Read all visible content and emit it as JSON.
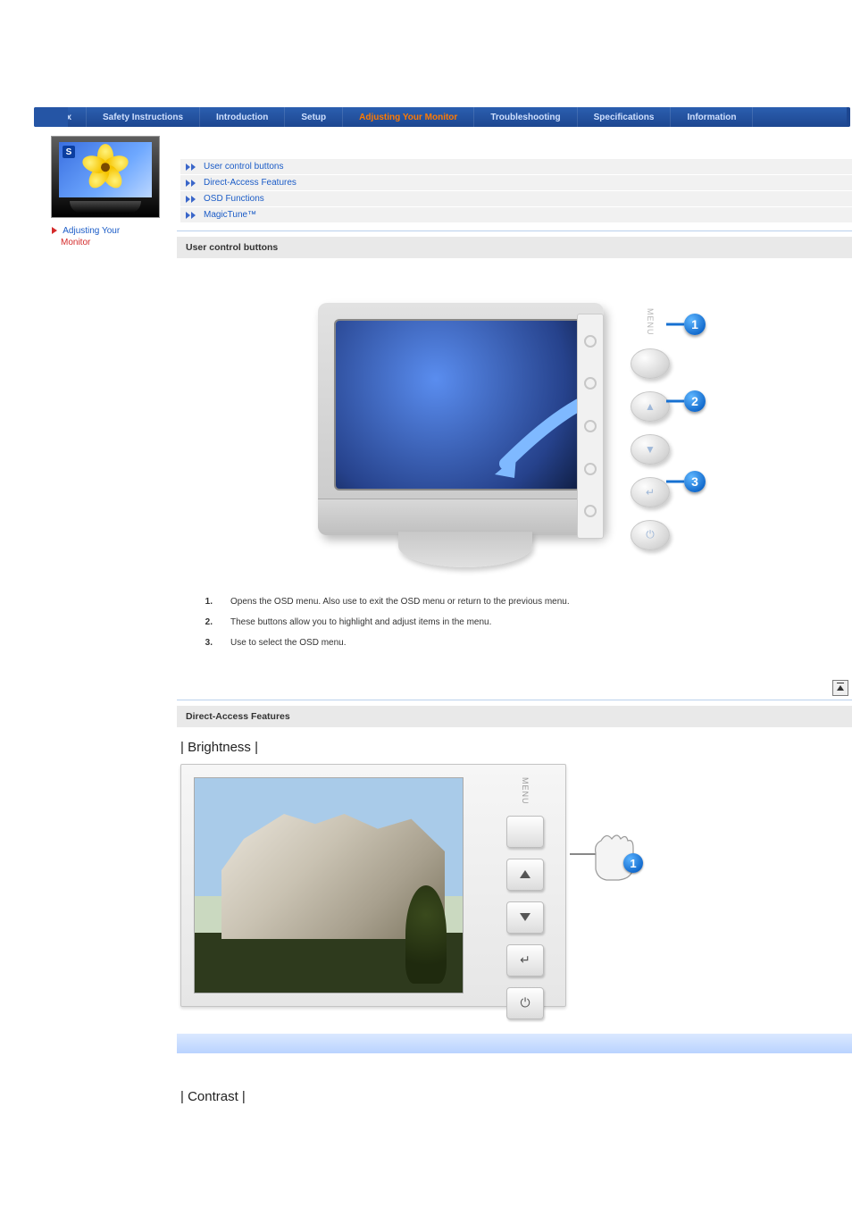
{
  "nav": {
    "index": "Index",
    "safety": "Safety Instructions",
    "intro": "Introduction",
    "setup": "Setup",
    "adjust": "Adjusting Your Monitor",
    "trouble": "Troubleshooting",
    "specs": "Specifications",
    "info": "Information"
  },
  "sidebar": {
    "label_line1": "Adjusting Your",
    "label_line2": "Monitor"
  },
  "links": {
    "l0": "User control buttons",
    "l1": "Direct-Access Features",
    "l2": "OSD Functions",
    "l3": "MagicTune™"
  },
  "section1_title": "User control buttons",
  "monitor_panel": {
    "menu_label": "MENU",
    "badge1": "1",
    "badge2": "2",
    "badge3": "3"
  },
  "desc": {
    "n1": "1.",
    "t1": "Opens the OSD menu. Also use to exit the OSD menu or return to the previous menu.",
    "n2": "2.",
    "t2": "These buttons allow you to highlight and adjust items in the menu.",
    "n3": "3.",
    "t3": "Use to select the OSD menu."
  },
  "section2_title": "Direct-Access Features",
  "brightness_title": "| Brightness |",
  "contrast_title": "| Contrast |",
  "bright_panel": {
    "menu": "MENU",
    "badge": "1"
  }
}
